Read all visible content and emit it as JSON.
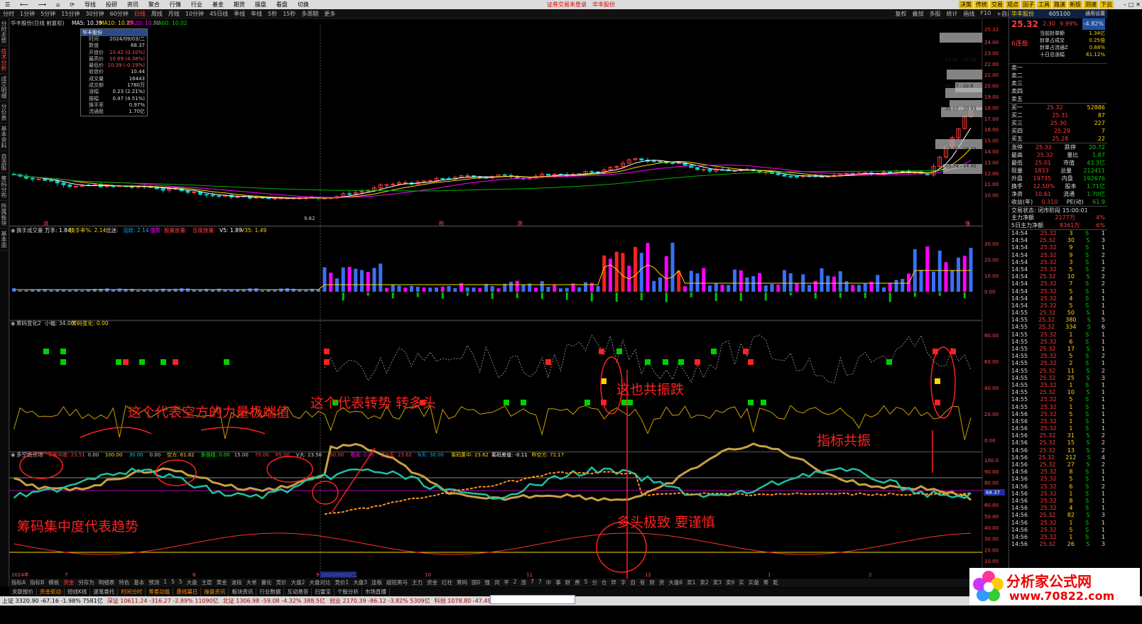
{
  "menu": {
    "items": [
      "☰",
      "⟵",
      "⟶",
      "⌂",
      "⟳",
      "导线",
      "投研",
      "资讯",
      "聚合",
      "行情",
      "行业",
      "基金",
      "期货",
      "操盘",
      "看盘",
      "切换"
    ],
    "center": "证券交易未登录",
    "stock_name": "华丰股份",
    "right_tabs": [
      "决策",
      "传统",
      "交易",
      "观点",
      "因子",
      "工具",
      "路演",
      "新版",
      "测速",
      "下云"
    ]
  },
  "periods": {
    "items": [
      "分时",
      "1分钟",
      "5分钟",
      "15分钟",
      "30分钟",
      "60分钟",
      "日线",
      "周线",
      "月线",
      "10分钟",
      "45日线",
      "季线",
      "年线",
      "5秒",
      "15秒",
      "多周期",
      "更多"
    ],
    "active": "日线",
    "right": [
      "复权",
      "叠加",
      "多股",
      "统计",
      "画线",
      "F10",
      "+自选",
      "返回"
    ]
  },
  "left_tabs": [
    "分时走势",
    "技术分析",
    "成交明细",
    "分价表",
    "基本资料",
    "自选股",
    "筹码分布",
    "所属板块",
    "基本面"
  ],
  "main": {
    "title": "华丰股份(日线 前复权)",
    "ma5": "MA5: 10.39",
    "ma10": "MA10: 10.27",
    "ma20": "MA20: 10.52",
    "ma60": "MA60: 10.02",
    "price_ticks": [
      "25.32",
      "24.00",
      "23.00",
      "22.00",
      "21.00",
      "20.00",
      "19.00",
      "18.00",
      "17.00",
      "16.00",
      "15.00",
      "14.00",
      "13.00",
      "12.00",
      "11.00",
      "10.00"
    ],
    "low_label": "9.82",
    "chip_labels": [
      "23.02 - 25.32",
      "20.57 - 22.8",
      "19.03 - 20.93",
      "17.72 - 18.43",
      "14.74 - 14.45"
    ],
    "markers": [
      "消",
      "税",
      "跌",
      "强"
    ]
  },
  "infobox": {
    "title": "华丰股份",
    "rows": [
      [
        "时间",
        "2024/09/03/二"
      ],
      [
        "数值",
        "68.37"
      ],
      [
        "开盘价",
        "10.42 (0.10%)"
      ],
      [
        "最高价",
        "10.69 (4.38%)"
      ],
      [
        "最低价",
        "10.39 (-0.19%)"
      ],
      [
        "收盘价",
        "10.44"
      ],
      [
        "成交量",
        "16443"
      ],
      [
        "成交额",
        "1780万"
      ],
      [
        "涨幅",
        "0.23 (2.21%)"
      ],
      [
        "振幅",
        "0.47 (4.51%)"
      ],
      [
        "换手率",
        "0.97%"
      ],
      [
        "流通股",
        "1.70亿"
      ]
    ]
  },
  "vol": {
    "label": "换手成交量",
    "shou": "万手: 1.84",
    "hsl": "换手率%: 2.14",
    "low": "低迷:",
    "zd": "活跃: 2.14",
    "qd": "强势:",
    "cmb": "股量放量:",
    "extra": "百度放量:",
    "v5": "V5: 1.89",
    "v35": "V35: 1.49",
    "ticks": [
      "30.00",
      "20.00",
      "10.00",
      "0.00"
    ]
  },
  "chip": {
    "label": "筹码变化2",
    "small": "小幅: 34.00",
    "var": "筹码变化: 0.00",
    "ticks": [
      "80.00",
      "60.00",
      "40.00",
      "20.00",
      "0.00"
    ]
  },
  "bottom_ind": {
    "label": "多空绝杀场",
    "items": [
      "平衡中度: 23.51",
      "0.00",
      "100.00",
      "30.00",
      "0.00",
      "空方: 61.82",
      "多倍线: 0.00",
      "15.00",
      "70.00",
      "85.00",
      "V大: 23.56",
      "50.00",
      "看涨: 0.00",
      "多N天: 23.62",
      "N天: 30.00",
      "筹码集中: 23.62",
      "筹码差值: -0.11",
      "昨空方: 72.17"
    ],
    "ticks": [
      "100.0",
      "90.00",
      "80.00",
      "70.00",
      "60.00",
      "50.00",
      "40.00",
      "30.00",
      "20.00",
      "10.00"
    ],
    "marker": "68.37",
    "date_axis": [
      "2024年",
      "7",
      "8",
      "9",
      "2024/09/03/二",
      "10",
      "11",
      "12",
      "1",
      "2"
    ]
  },
  "annotations": [
    "这个代表空方的力量极端值",
    "这个代表转势 转多头",
    "这也共振跌",
    "指标共振",
    "筹码集中度代表趋势",
    "多头极致 要谨慎"
  ],
  "tabs1": [
    "指标A",
    "指标B",
    "模板",
    "资金",
    "另存为",
    "明细表",
    "特色",
    "基本",
    "预测",
    "1",
    "5",
    "5",
    "大盘",
    "主层",
    "黄金",
    "波段",
    "大单",
    "量化",
    "竞价",
    "大盘2",
    "大盘对比",
    "竞价1",
    "大盘3",
    "连板",
    "超短黑马",
    "主力",
    "资金",
    "红柱",
    "筹码",
    "国0",
    "强",
    "词",
    "平",
    "2",
    "涨",
    "7",
    "7",
    "中",
    "事",
    "财",
    "费",
    "5",
    "分",
    "仓",
    "异",
    "字",
    "自",
    "有",
    "财",
    "资",
    "大盘6",
    "卖1",
    "卖2",
    "卖3",
    "卖9",
    "实",
    "实盘",
    "筹",
    "乾"
  ],
  "tabs2": [
    "关联报价",
    "资金驱动",
    "短线K线",
    "逐笔委托",
    "时间分时",
    "筹委功能",
    "悬线幕日",
    "操盘资讯",
    "板块资讯",
    "行业数据",
    "互动易答",
    "扫雷宝",
    "个股分析",
    "市场直播"
  ],
  "status": {
    "items": [
      "上证 3320.90 -67.16 -1.98% 7581亿",
      "深证 10611.24 -316.27 -2.89% 11090亿",
      "北证 1306.98 -59.08 -4.32% 388.5亿",
      "创业 2170.39 -86.12 -3.82% 5309亿",
      "科创 1078.80 -47.49 -4.22% 1899亿"
    ]
  },
  "right": {
    "name": "华丰股份",
    "code": "605100",
    "price": "25.32",
    "chg": "2.30",
    "pct": "9.99%",
    "btn": "通用设置",
    "badge": "-4.82%",
    "limit": "6连板",
    "feng": [
      [
        "当前封单额",
        "1.34亿"
      ],
      [
        "封单占成交",
        "0.25倍"
      ],
      [
        "封单占流通Z",
        "0.88%"
      ],
      [
        "十日总涨幅",
        "61.12%"
      ]
    ],
    "asks": [
      [
        "卖一",
        "",
        ""
      ],
      [
        "卖二",
        "",
        ""
      ],
      [
        "卖三",
        "",
        ""
      ],
      [
        "卖四",
        "",
        ""
      ],
      [
        "卖五",
        "",
        ""
      ]
    ],
    "bids": [
      [
        "买一",
        "25.32",
        "52886"
      ],
      [
        "买二",
        "25.31",
        "87"
      ],
      [
        "买三",
        "25.30",
        "227"
      ],
      [
        "买四",
        "25.29",
        "7"
      ],
      [
        "买五",
        "25.28",
        "22"
      ]
    ],
    "stats": [
      [
        "涨停",
        "25.32",
        "跌停",
        "20.72"
      ],
      [
        "最高",
        "25.32",
        "量比",
        "1.87"
      ],
      [
        "最低",
        "25.01",
        "市值",
        "43.3亿"
      ],
      [
        "现量",
        "1833",
        "总量",
        "212411"
      ],
      [
        "外盘",
        "19735",
        "内盘",
        "192676"
      ],
      [
        "换手",
        "12.50%",
        "股本",
        "1.71亿"
      ],
      [
        "净资",
        "10.61",
        "流通",
        "1.70亿"
      ],
      [
        "收益(年)",
        "0.310",
        "PE(动)",
        "61.9"
      ]
    ],
    "trade_state": "交易状态: 闭市阶段 15:00:01",
    "main_flow": [
      "主力净额",
      "2177万",
      "4%"
    ],
    "main5": [
      "5日主力净额",
      "8361万",
      "6%"
    ],
    "ticks": [
      [
        "14:54",
        "25.32",
        "3",
        "S",
        "1"
      ],
      [
        "14:54",
        "25.32",
        "30",
        "S",
        "3"
      ],
      [
        "14:54",
        "25.32",
        "9",
        "S",
        "1"
      ],
      [
        "14:54",
        "25.32",
        "9",
        "S",
        "2"
      ],
      [
        "14:54",
        "25.32",
        "3",
        "S",
        "1"
      ],
      [
        "14:54",
        "25.32",
        "5",
        "S",
        "2"
      ],
      [
        "14:54",
        "25.32",
        "10",
        "S",
        "2"
      ],
      [
        "14:54",
        "25.32",
        "7",
        "S",
        "2"
      ],
      [
        "14:54",
        "25.32",
        "5",
        "S",
        "1"
      ],
      [
        "14:54",
        "25.32",
        "4",
        "S",
        "1"
      ],
      [
        "14:54",
        "25.32",
        "5",
        "S",
        "1"
      ],
      [
        "14:55",
        "25.32",
        "50",
        "S",
        "1"
      ],
      [
        "14:55",
        "25.32",
        "380",
        "S",
        "5"
      ],
      [
        "14:55",
        "25.32",
        "334",
        "S",
        "6"
      ],
      [
        "14:55",
        "25.32",
        "1",
        "S",
        "1"
      ],
      [
        "14:55",
        "25.32",
        "6",
        "S",
        "1"
      ],
      [
        "14:55",
        "25.32",
        "17",
        "S",
        "1"
      ],
      [
        "14:55",
        "25.32",
        "5",
        "S",
        "2"
      ],
      [
        "14:55",
        "25.32",
        "2",
        "S",
        "1"
      ],
      [
        "14:55",
        "25.32",
        "11",
        "S",
        "2"
      ],
      [
        "14:55",
        "25.32",
        "25",
        "S",
        "3"
      ],
      [
        "14:55",
        "25.32",
        "1",
        "S",
        "1"
      ],
      [
        "14:55",
        "25.32",
        "10",
        "S",
        "1"
      ],
      [
        "14:55",
        "25.32",
        "5",
        "S",
        "1"
      ],
      [
        "14:55",
        "25.32",
        "1",
        "S",
        "1"
      ],
      [
        "14:56",
        "25.32",
        "5",
        "S",
        "1"
      ],
      [
        "14:56",
        "25.32",
        "1",
        "S",
        "1"
      ],
      [
        "14:56",
        "25.32",
        "1",
        "S",
        "1"
      ],
      [
        "14:56",
        "25.32",
        "31",
        "S",
        "2"
      ],
      [
        "14:56",
        "25.32",
        "15",
        "S",
        "2"
      ],
      [
        "14:56",
        "25.32",
        "13",
        "S",
        "2"
      ],
      [
        "14:56",
        "25.32",
        "212",
        "S",
        "4"
      ],
      [
        "14:56",
        "25.32",
        "27",
        "S",
        "2"
      ],
      [
        "14:56",
        "25.32",
        "8",
        "S",
        "1"
      ],
      [
        "14:56",
        "25.32",
        "5",
        "S",
        "1"
      ],
      [
        "14:56",
        "25.32",
        "6",
        "S",
        "2"
      ],
      [
        "14:56",
        "25.32",
        "1",
        "S",
        "1"
      ],
      [
        "14:56",
        "25.32",
        "8",
        "S",
        "1"
      ],
      [
        "14:56",
        "25.32",
        "4",
        "S",
        "1"
      ],
      [
        "14:56",
        "25.32",
        "82",
        "S",
        "3"
      ],
      [
        "14:56",
        "25.32",
        "1",
        "S",
        "1"
      ],
      [
        "14:56",
        "25.32",
        "5",
        "S",
        "1"
      ],
      [
        "14:56",
        "25.32",
        "1",
        "S",
        "1"
      ],
      [
        "14:56",
        "25.32",
        "26",
        "S",
        "3"
      ]
    ]
  },
  "logo": {
    "t1": "分析家公式网",
    "t2": "www.70822.com"
  },
  "colors": {
    "up": "#ff3b3b",
    "down": "#00d0d0",
    "ma5": "#ffffff",
    "ma10": "#ffd700",
    "ma20": "#ff00ff",
    "ma60": "#00b000"
  }
}
